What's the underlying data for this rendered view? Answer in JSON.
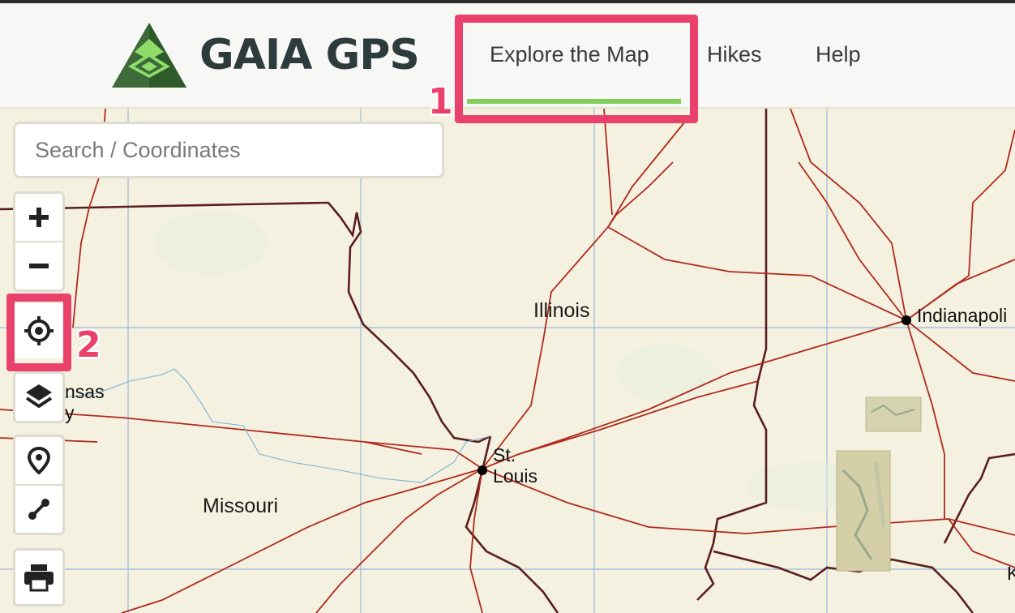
{
  "header": {
    "logo_text": "GAIA GPS",
    "nav": [
      {
        "label": "Explore the Map"
      },
      {
        "label": "Hikes"
      },
      {
        "label": "Help"
      }
    ],
    "accent_color": "#7fcf5a"
  },
  "annotations": {
    "step1": "1",
    "step2": "2",
    "highlight_color": "#e9416c"
  },
  "search": {
    "placeholder": "Search / Coordinates"
  },
  "controls": {
    "zoom": [
      "plus-icon",
      "minus-icon"
    ],
    "locate": "crosshair-icon",
    "layers": "layers-icon",
    "tools": [
      "map-pin-icon",
      "route-icon"
    ],
    "print": "printer-icon"
  },
  "map": {
    "states": {
      "illinois": "Illinois",
      "missouri": "Missouri"
    },
    "cities": {
      "st_louis_line1": "St.",
      "st_louis_line2": "Louis",
      "indianapolis": "Indianapoli",
      "kansas_line1": "nsas",
      "kansas_line2": "y",
      "edge_k": "K"
    }
  }
}
